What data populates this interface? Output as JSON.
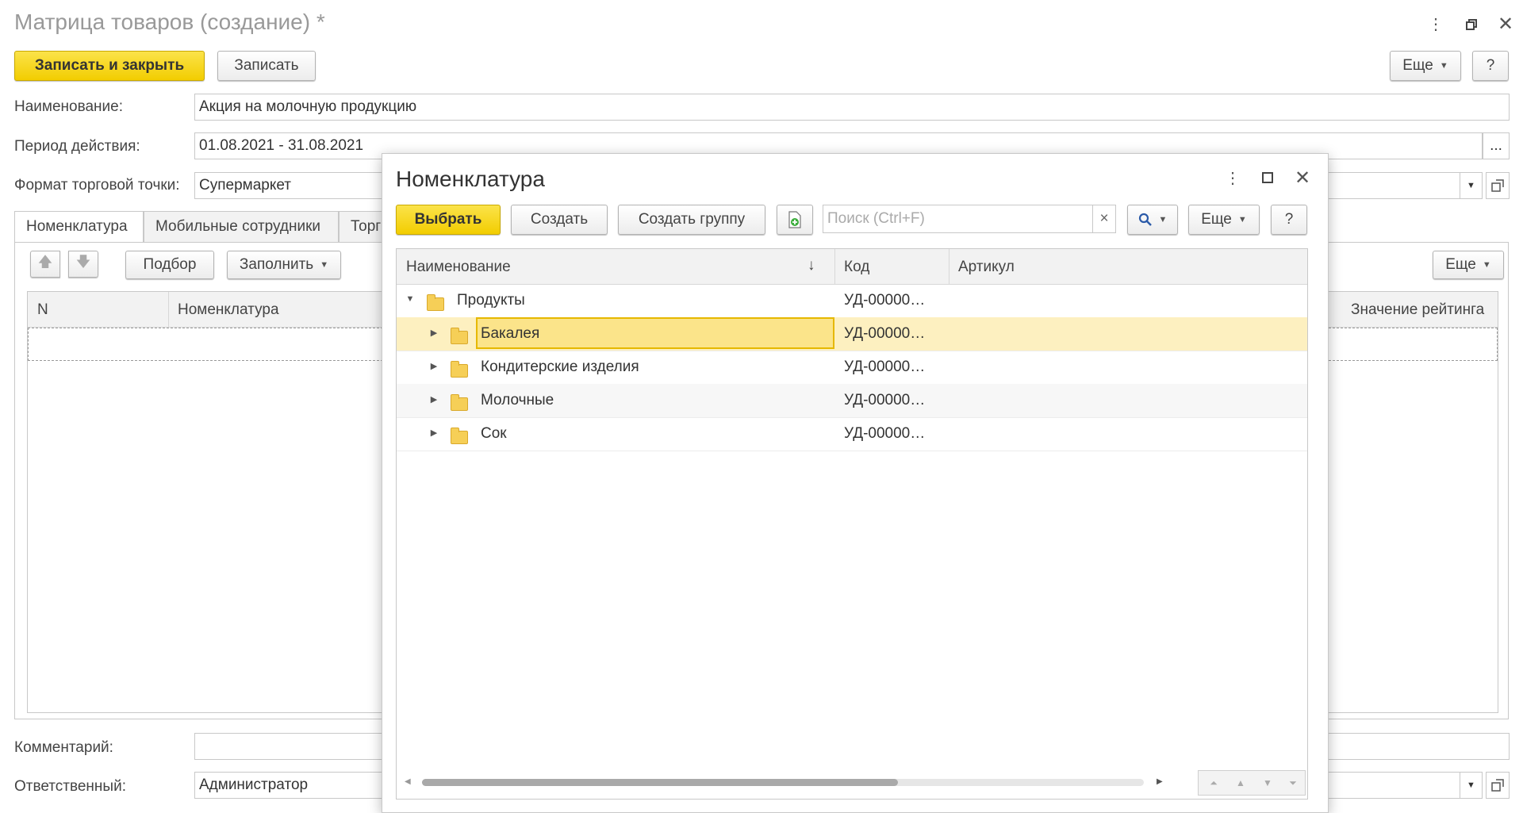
{
  "window": {
    "title": "Матрица товаров (создание) *",
    "save_close": "Записать и закрыть",
    "save": "Записать",
    "more": "Еще",
    "help": "?"
  },
  "form": {
    "name_label": "Наименование:",
    "name_value": "Акция на молочную продукцию",
    "period_label": "Период действия:",
    "period_value": "01.08.2021 - 31.08.2021",
    "period_btn": "...",
    "format_label": "Формат торговой точки:",
    "format_value": "Супермаркет",
    "comment_label": "Комментарий:",
    "comment_value": "",
    "responsible_label": "Ответственный:",
    "responsible_value": "Администратор"
  },
  "tabs": [
    "Номенклатура",
    "Мобильные сотрудники",
    "Торг"
  ],
  "tab_toolbar": {
    "pick": "Подбор",
    "fill": "Заполнить",
    "more": "Еще"
  },
  "table": {
    "col_n": "N",
    "col_item": "Номенклатура",
    "col_rating": "Значение рейтинга"
  },
  "dialog": {
    "title": "Номенклатура",
    "select": "Выбрать",
    "create": "Создать",
    "create_group": "Создать группу",
    "search_placeholder": "Поиск (Ctrl+F)",
    "clear": "×",
    "more": "Еще",
    "help": "?",
    "col_name": "Наименование",
    "sort_arrow": "↓",
    "col_code": "Код",
    "col_article": "Артикул",
    "rows": [
      {
        "name": "Продукты",
        "code": "УД-00000…",
        "expanded": true,
        "level": 0
      },
      {
        "name": "Бакалея",
        "code": "УД-00000…",
        "expanded": false,
        "level": 1,
        "selected": true
      },
      {
        "name": "Кондитерские изделия",
        "code": "УД-00000…",
        "expanded": false,
        "level": 1
      },
      {
        "name": "Молочные",
        "code": "УД-00000…",
        "expanded": false,
        "level": 1
      },
      {
        "name": "Сок",
        "code": "УД-00000…",
        "expanded": false,
        "level": 1
      }
    ]
  },
  "colors": {
    "accent_yellow": "#f2cd00",
    "selected_row": "#fbe8a0",
    "selected_cell_border": "#e6b800"
  }
}
